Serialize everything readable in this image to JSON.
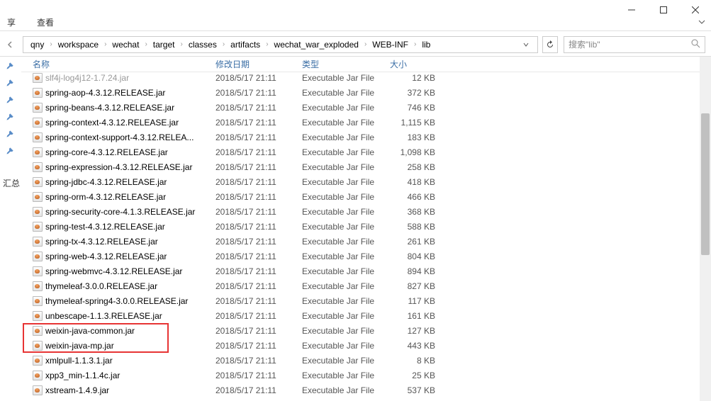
{
  "windowControls": {
    "min": "minimize",
    "max": "maximize",
    "close": "close"
  },
  "menubar": {
    "items": [
      "享",
      "查看"
    ]
  },
  "breadcrumb": {
    "segments": [
      "qny",
      "workspace",
      "wechat",
      "target",
      "classes",
      "artifacts",
      "wechat_war_exploded",
      "WEB-INF",
      "lib"
    ]
  },
  "search": {
    "placeholder": "搜索\"lib\""
  },
  "quickAccess": {
    "label": "汇总"
  },
  "columns": {
    "name": "名称",
    "date": "修改日期",
    "type": "类型",
    "size": "大小"
  },
  "files": [
    {
      "name": "slf4j-log4j12-1.7.24.jar",
      "date": "2018/5/17 21:11",
      "type": "Executable Jar File",
      "size": "12 KB"
    },
    {
      "name": "spring-aop-4.3.12.RELEASE.jar",
      "date": "2018/5/17 21:11",
      "type": "Executable Jar File",
      "size": "372 KB"
    },
    {
      "name": "spring-beans-4.3.12.RELEASE.jar",
      "date": "2018/5/17 21:11",
      "type": "Executable Jar File",
      "size": "746 KB"
    },
    {
      "name": "spring-context-4.3.12.RELEASE.jar",
      "date": "2018/5/17 21:11",
      "type": "Executable Jar File",
      "size": "1,115 KB"
    },
    {
      "name": "spring-context-support-4.3.12.RELEA...",
      "date": "2018/5/17 21:11",
      "type": "Executable Jar File",
      "size": "183 KB"
    },
    {
      "name": "spring-core-4.3.12.RELEASE.jar",
      "date": "2018/5/17 21:11",
      "type": "Executable Jar File",
      "size": "1,098 KB"
    },
    {
      "name": "spring-expression-4.3.12.RELEASE.jar",
      "date": "2018/5/17 21:11",
      "type": "Executable Jar File",
      "size": "258 KB"
    },
    {
      "name": "spring-jdbc-4.3.12.RELEASE.jar",
      "date": "2018/5/17 21:11",
      "type": "Executable Jar File",
      "size": "418 KB"
    },
    {
      "name": "spring-orm-4.3.12.RELEASE.jar",
      "date": "2018/5/17 21:11",
      "type": "Executable Jar File",
      "size": "466 KB"
    },
    {
      "name": "spring-security-core-4.1.3.RELEASE.jar",
      "date": "2018/5/17 21:11",
      "type": "Executable Jar File",
      "size": "368 KB"
    },
    {
      "name": "spring-test-4.3.12.RELEASE.jar",
      "date": "2018/5/17 21:11",
      "type": "Executable Jar File",
      "size": "588 KB"
    },
    {
      "name": "spring-tx-4.3.12.RELEASE.jar",
      "date": "2018/5/17 21:11",
      "type": "Executable Jar File",
      "size": "261 KB"
    },
    {
      "name": "spring-web-4.3.12.RELEASE.jar",
      "date": "2018/5/17 21:11",
      "type": "Executable Jar File",
      "size": "804 KB"
    },
    {
      "name": "spring-webmvc-4.3.12.RELEASE.jar",
      "date": "2018/5/17 21:11",
      "type": "Executable Jar File",
      "size": "894 KB"
    },
    {
      "name": "thymeleaf-3.0.0.RELEASE.jar",
      "date": "2018/5/17 21:11",
      "type": "Executable Jar File",
      "size": "827 KB"
    },
    {
      "name": "thymeleaf-spring4-3.0.0.RELEASE.jar",
      "date": "2018/5/17 21:11",
      "type": "Executable Jar File",
      "size": "117 KB"
    },
    {
      "name": "unbescape-1.1.3.RELEASE.jar",
      "date": "2018/5/17 21:11",
      "type": "Executable Jar File",
      "size": "161 KB"
    },
    {
      "name": "weixin-java-common.jar",
      "date": "2018/5/17 21:11",
      "type": "Executable Jar File",
      "size": "127 KB"
    },
    {
      "name": "weixin-java-mp.jar",
      "date": "2018/5/17 21:11",
      "type": "Executable Jar File",
      "size": "443 KB"
    },
    {
      "name": "xmlpull-1.1.3.1.jar",
      "date": "2018/5/17 21:11",
      "type": "Executable Jar File",
      "size": "8 KB"
    },
    {
      "name": "xpp3_min-1.1.4c.jar",
      "date": "2018/5/17 21:11",
      "type": "Executable Jar File",
      "size": "25 KB"
    },
    {
      "name": "xstream-1.4.9.jar",
      "date": "2018/5/17 21:11",
      "type": "Executable Jar File",
      "size": "537 KB"
    }
  ]
}
